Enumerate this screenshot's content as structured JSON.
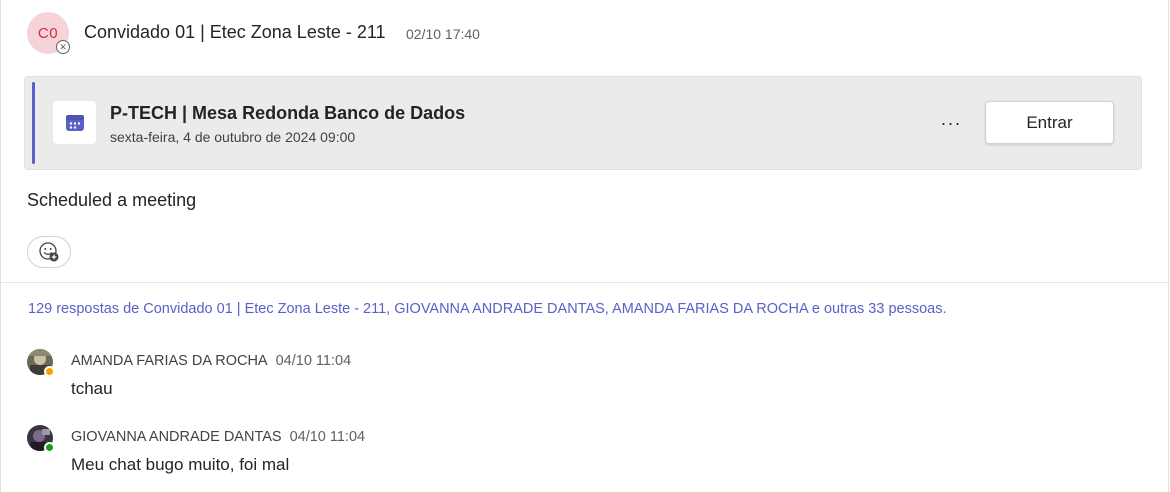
{
  "post": {
    "avatar_initials": "C0",
    "author": "Convidado 01 | Etec Zona Leste - 211",
    "time": "02/10 17:40",
    "presence": "offline",
    "body": "Scheduled a meeting"
  },
  "meeting": {
    "icon": "calendar-icon",
    "title": "P-TECH | Mesa Redonda Banco de Dados",
    "date": "sexta-feira, 4 de outubro de 2024 09:00",
    "more_label": "···",
    "join_label": "Entrar"
  },
  "replies_summary": "129 respostas de Convidado 01 | Etec Zona Leste - 211, GIOVANNA ANDRADE DANTAS, AMANDA FARIAS DA ROCHA e outras 33 pessoas.",
  "replies": [
    {
      "author": "AMANDA FARIAS DA ROCHA",
      "time": "04/10 11:04",
      "text": "tchau",
      "presence_color": "#f8a100"
    },
    {
      "author": "GIOVANNA ANDRADE DANTAS",
      "time": "04/10 11:04",
      "text": "Meu chat bugo muito, foi mal",
      "presence_color": "#13a10e"
    }
  ],
  "colors": {
    "accent": "#5b5fc7",
    "avatar_bg": "#f6d3d6",
    "avatar_fg": "#c4314b"
  }
}
